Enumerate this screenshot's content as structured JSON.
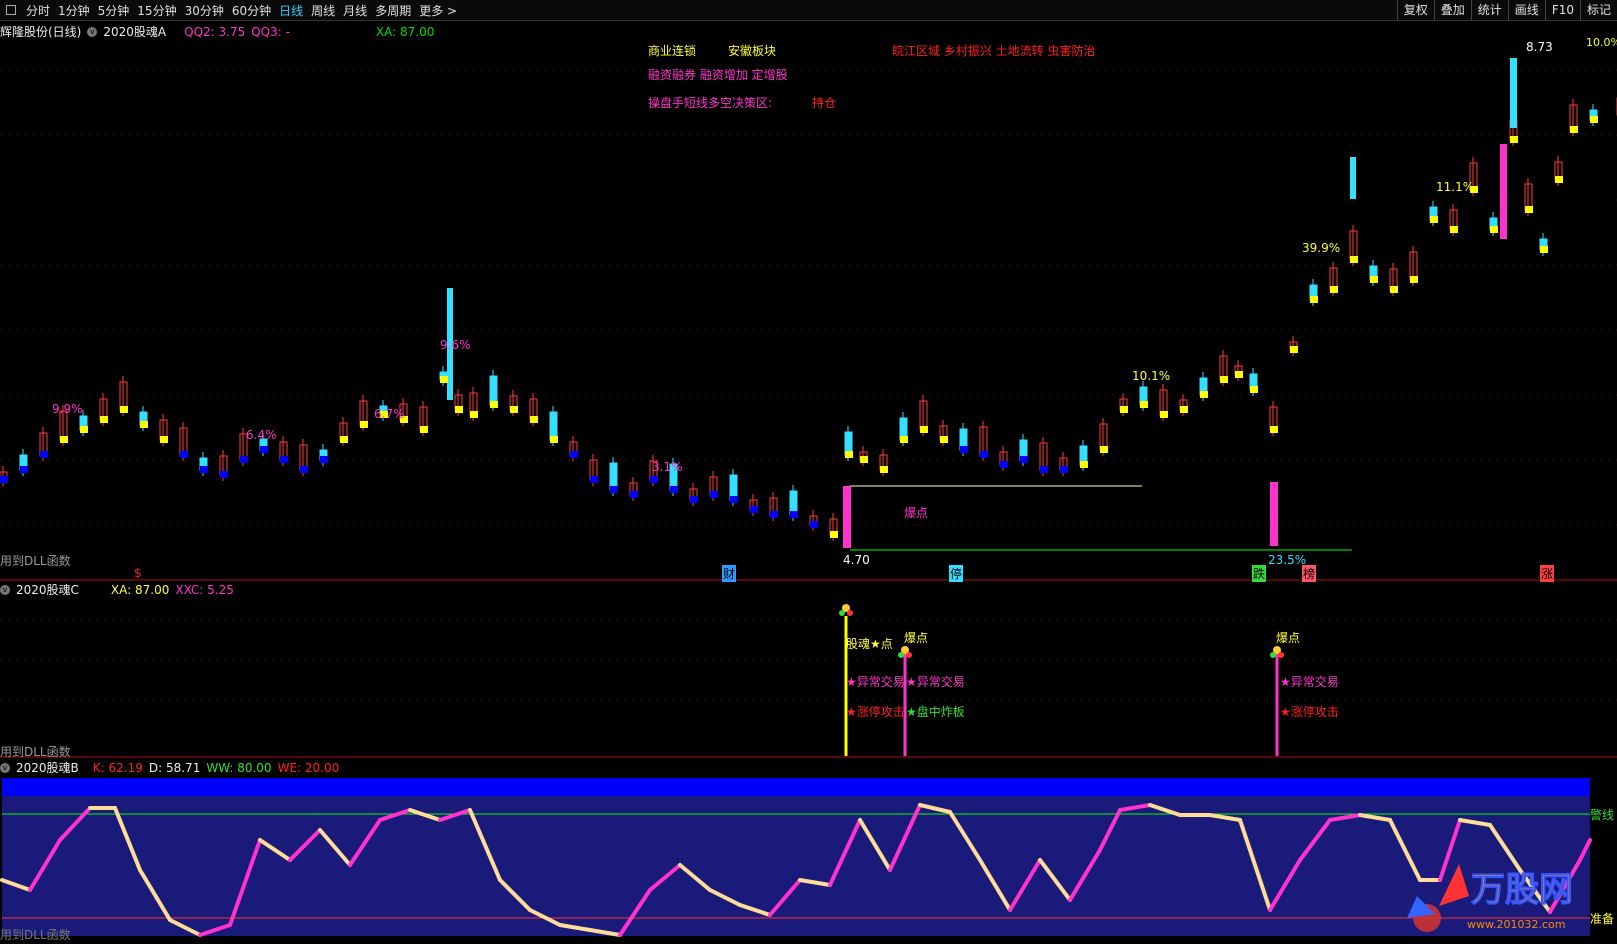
{
  "toolbar": {
    "periods": [
      "分时",
      "1分钟",
      "5分钟",
      "15分钟",
      "30分钟",
      "60分钟",
      "日线",
      "周线",
      "月线",
      "多周期",
      "更多 >"
    ],
    "active": "日线",
    "right_buttons": [
      "复权",
      "叠加",
      "统计",
      "画线",
      "F10",
      "标记"
    ]
  },
  "main_panel": {
    "stock_name": "辉隆股份(日线)",
    "indicator_name": "2020股魂A",
    "qq2_label": "QQ2: 3.75",
    "qq3_label": "QQ3: -",
    "xa_label": "XA: 87.00",
    "concepts": {
      "c1": "商业连锁",
      "c2": "安徽板块",
      "c3": "皖江区域 乡村振兴 土地流转 虫害防治",
      "c4": "融资融券 融资增加 定增股",
      "c5": "操盘手短线多空决策区:",
      "c6": "持仓"
    },
    "pct_labels": [
      "9.9%",
      "6.4%",
      "6.7%",
      "9.6%",
      "3.1%",
      "10.1%",
      "39.9%",
      "11.1%",
      "23.5%"
    ],
    "price_high": "8.73",
    "price_low": "4.70",
    "right_edge_label": "10.0%",
    "baodian": "爆点",
    "dll": "用到DLL函数",
    "markers": [
      "$",
      "财",
      "停",
      "跌",
      "榜",
      "涨"
    ]
  },
  "c_panel": {
    "indicator_name": "2020股魂C",
    "xa": "XA: 87.00",
    "xxc": "XXC: 5.25",
    "signals": {
      "s1": "股魂★点",
      "s2": "爆点",
      "s3": "爆点",
      "s4": "★异常交易",
      "s5": "★异常交易",
      "s6": "★异常交易",
      "s7": "★涨停攻击",
      "s8": "★盘中炸板",
      "s9": "★涨停攻击"
    },
    "dll": "用到DLL函数"
  },
  "b_panel": {
    "indicator_name": "2020股魂B",
    "k": "K: 62.19",
    "d": "D: 58.71",
    "ww": "WW: 80.00",
    "we": "WE: 20.00",
    "warn": "警线",
    "ready": "准备",
    "dll": "用到DLL函数"
  },
  "watermark": {
    "brand": "万股网",
    "url": "www.201032.com"
  },
  "colors": {
    "up": "#ff3b3b",
    "down": "#33e0ff",
    "yellow": "#ffff00",
    "blue": "#0000ff",
    "magenta": "#ff33cc",
    "green": "#00ff00"
  }
}
